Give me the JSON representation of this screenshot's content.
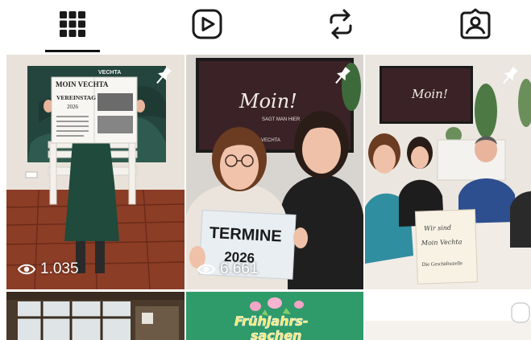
{
  "tabs": [
    {
      "name": "grid",
      "icon": "grid-icon",
      "active": true
    },
    {
      "name": "reels",
      "icon": "play-icon",
      "active": false
    },
    {
      "name": "reposts",
      "icon": "repost-icon",
      "active": false
    },
    {
      "name": "tagged",
      "icon": "tagged-person-icon",
      "active": false
    }
  ],
  "posts": {
    "p1": {
      "views": "1.035",
      "pinned": true,
      "newspaper": {
        "masthead": "MOIN VECHTA",
        "headline": "VEREINSTAG",
        "year": "2026",
        "banner": "VECHTA"
      }
    },
    "p2": {
      "views": "6.661",
      "pinned": true,
      "sign_line1": "TERMINE",
      "sign_line2": "2026",
      "screen_title": "Moin!",
      "screen_sub": "SAGT MAN HIER",
      "screen_foot": "VECHTA"
    },
    "p3": {
      "pinned": true,
      "screen_title": "Moin!",
      "card_line1": "Wir sind",
      "card_line2": "Moin Vechta",
      "card_line3": "Die Geschäftsstelle"
    },
    "p5": {
      "banner_line1": "Frühjahrs-",
      "banner_line2": "sachen"
    }
  },
  "colors": {
    "icon": "#1a1a1a",
    "active_underline": "#111111",
    "green_banner": "#2f9a6a"
  }
}
